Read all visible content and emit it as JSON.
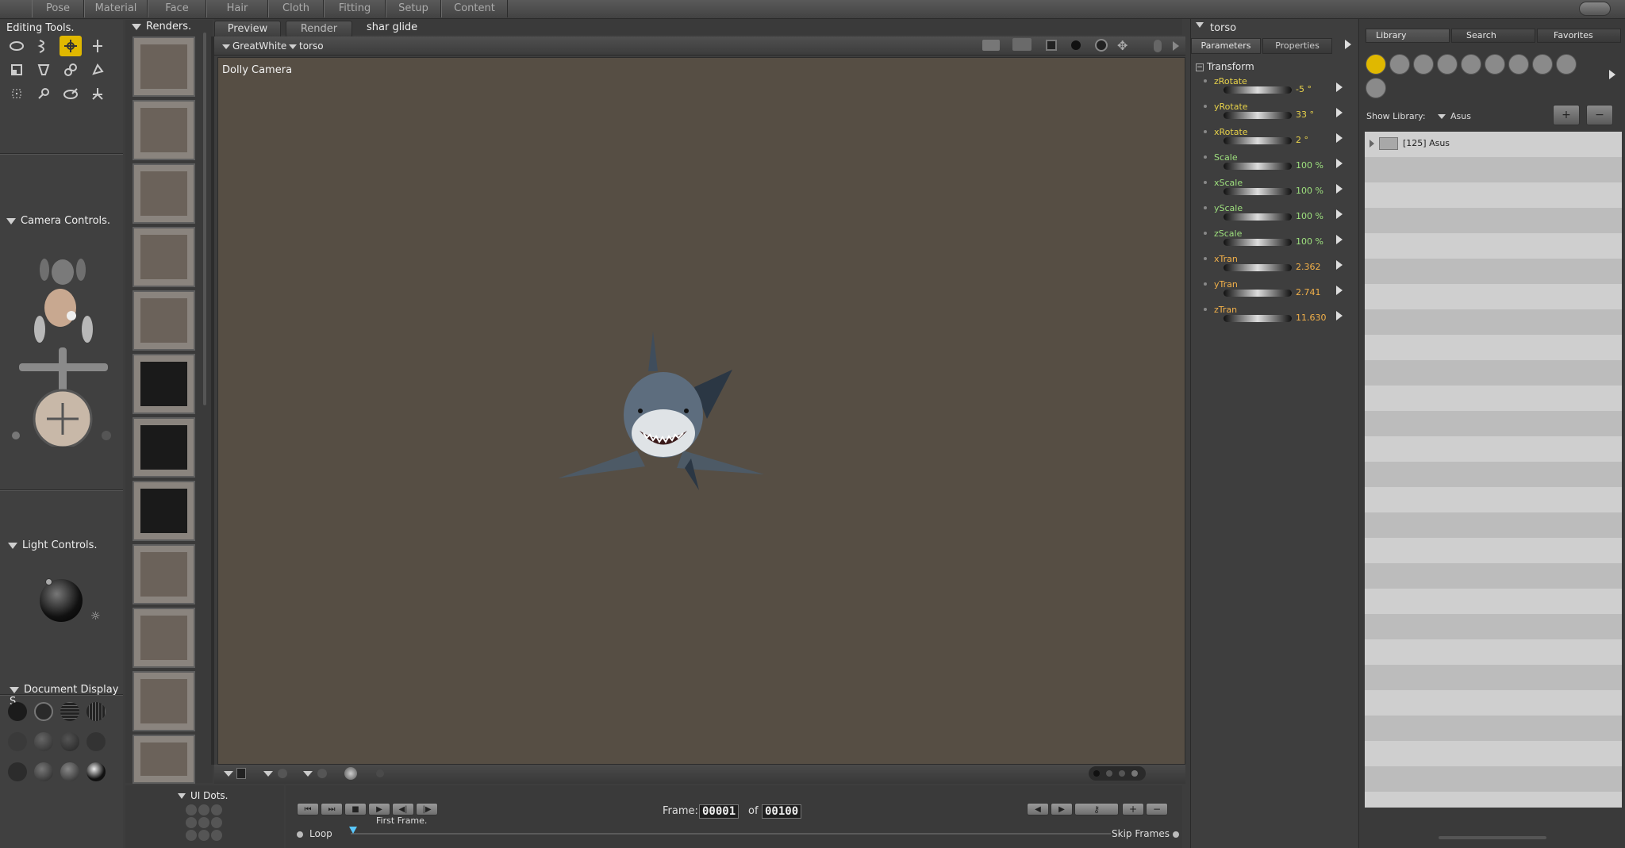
{
  "room_tabs": [
    "Pose",
    "Material",
    "Face",
    "Hair",
    "Cloth",
    "Fitting",
    "Setup",
    "Content"
  ],
  "active_room": "Pose",
  "editing_tools": {
    "title": "Editing Tools."
  },
  "camera_controls": {
    "title": "Camera Controls."
  },
  "light_controls": {
    "title": "Light Controls."
  },
  "document_display": {
    "title": "Document Display S"
  },
  "renders": {
    "title": "Renders."
  },
  "ui_dots": {
    "title": "UI Dots."
  },
  "document": {
    "tabs": [
      "Preview",
      "Render"
    ],
    "active_tab": "Preview",
    "scene_name": "shar glide",
    "figure_menu": "GreatWhite",
    "actor_menu": "torso",
    "camera_label": "Dolly Camera"
  },
  "params": {
    "actor": "torso",
    "tabs": [
      "Parameters",
      "Properties"
    ],
    "group": "Transform",
    "items": [
      {
        "name": "zRotate",
        "value": "-5 °",
        "color": "#e8d24a"
      },
      {
        "name": "yRotate",
        "value": "33 °",
        "color": "#e8d24a"
      },
      {
        "name": "xRotate",
        "value": "2 °",
        "color": "#e8d24a"
      },
      {
        "name": "Scale",
        "value": "100 %",
        "color": "#9ee07e"
      },
      {
        "name": "xScale",
        "value": "100 %",
        "color": "#9ee07e"
      },
      {
        "name": "yScale",
        "value": "100 %",
        "color": "#9ee07e"
      },
      {
        "name": "zScale",
        "value": "100 %",
        "color": "#9ee07e"
      },
      {
        "name": "xTran",
        "value": "2.362",
        "color": "#f3b14a"
      },
      {
        "name": "yTran",
        "value": "2.741",
        "color": "#f3b14a"
      },
      {
        "name": "zTran",
        "value": "11.630",
        "color": "#f3b14a"
      }
    ]
  },
  "library": {
    "tabs": [
      "Library",
      "Search",
      "Favorites"
    ],
    "show_label": "Show Library:",
    "show_value": "Asus",
    "item": "[125] Asus"
  },
  "timeline": {
    "frame_label": "Frame:",
    "frame_value": "00001",
    "of_label": "of",
    "total_value": "00100",
    "first_frame": "First Frame.",
    "loop": "Loop",
    "skip_frames": "Skip Frames"
  }
}
